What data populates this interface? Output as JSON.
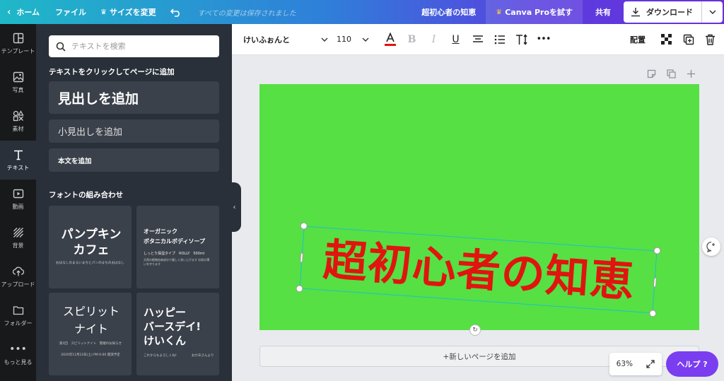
{
  "topbar": {
    "home": "ホーム",
    "file": "ファイル",
    "resize": "サイズを変更",
    "saved": "すべての変更は保存されました",
    "doc_title": "超初心者の知恵",
    "pro": "Canva Proを試す",
    "share": "共有",
    "download": "ダウンロード"
  },
  "rail": [
    {
      "label": "テンプレート",
      "icon": "template-icon"
    },
    {
      "label": "写真",
      "icon": "photo-icon"
    },
    {
      "label": "素材",
      "icon": "elements-icon"
    },
    {
      "label": "テキスト",
      "icon": "text-icon"
    },
    {
      "label": "動画",
      "icon": "video-icon"
    },
    {
      "label": "背景",
      "icon": "background-icon"
    },
    {
      "label": "アップロード",
      "icon": "upload-icon"
    },
    {
      "label": "フォルダー",
      "icon": "folder-icon"
    },
    {
      "label": "もっと見る",
      "icon": "more-icon"
    }
  ],
  "panel": {
    "search_placeholder": "テキストを検索",
    "click_to_add": "テキストをクリックしてページに追加",
    "add_heading": "見出しを追加",
    "add_subheading": "小見出しを追加",
    "add_body": "本文を追加",
    "font_combos": "フォントの組み合わせ",
    "combo1": {
      "title": "パンプキン\nカフェ",
      "sub": "おはなしのまるいまちとパンのまちのおはなし"
    },
    "combo2": {
      "title": "オーガニック\nボタニカルボディソープ",
      "sub": "しっとり保湿タイプ　ROLLY　500ml",
      "fine": "天然の植物由来成分で優しく洗い上げます お肌の潤いを守ります"
    },
    "combo3": {
      "title": "スピリット\nナイト",
      "sub": "第1回　スピリットナイト　開催のお知らせ",
      "date": "2020年11月12日(土) PM 6:00 開演予定"
    },
    "combo4": {
      "title": "ハッピー\nバースデイ!\nけいくん",
      "sub": "これからもよろしくね!",
      "sign": "おかあさんより"
    }
  },
  "toolbar": {
    "font": "けいふぉんと",
    "size": "110",
    "arrange": "配置"
  },
  "canvas": {
    "headline": "超初心者の知恵",
    "bg_color": "#56e044",
    "text_color": "#e0150f",
    "new_page": "+新しいページを追加"
  },
  "footer": {
    "zoom": "63%",
    "help": "ヘルプ ?"
  }
}
